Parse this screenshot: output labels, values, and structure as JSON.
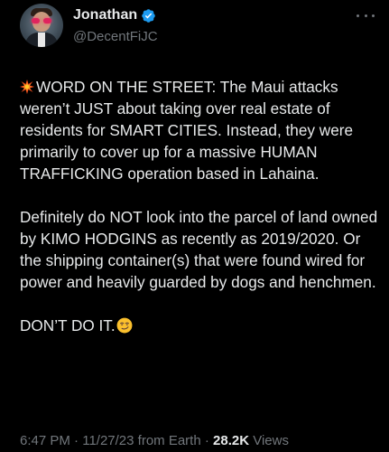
{
  "author": {
    "display_name": "Jonathan",
    "handle": "@DecentFiJC",
    "verified": true,
    "avatar_icon": "profile-photo-icon"
  },
  "tweet": {
    "paragraphs": [
      {
        "leading_icon": "collision-emoji-icon",
        "text": "WORD ON THE STREET: The Maui attacks weren’t JUST about taking over real estate of residents for SMART CITIES. Instead, they were primarily to cover up for a massive HUMAN TRAFFICKING operation based in Lahaina."
      },
      {
        "text": "Definitely do NOT look into the parcel of land owned by KIMO HODGINS as recently as 2019/2020. Or the shipping container(s) that were found wired for power and heavily guarded by dogs and henchmen."
      },
      {
        "text": "DON’T DO IT.",
        "trailing_icon": "smirking-face-emoji-icon"
      }
    ]
  },
  "meta": {
    "time": "6:47 PM",
    "separator_1": " · ",
    "date": "11/27/23",
    "source": " from Earth",
    "separator_2": " · ",
    "views_count": "28.2K",
    "views_label": " Views"
  },
  "colors": {
    "background": "#000000",
    "primary_text": "#e7e9ea",
    "secondary_text": "#71767b",
    "verified_badge": "#1d9bf0"
  }
}
